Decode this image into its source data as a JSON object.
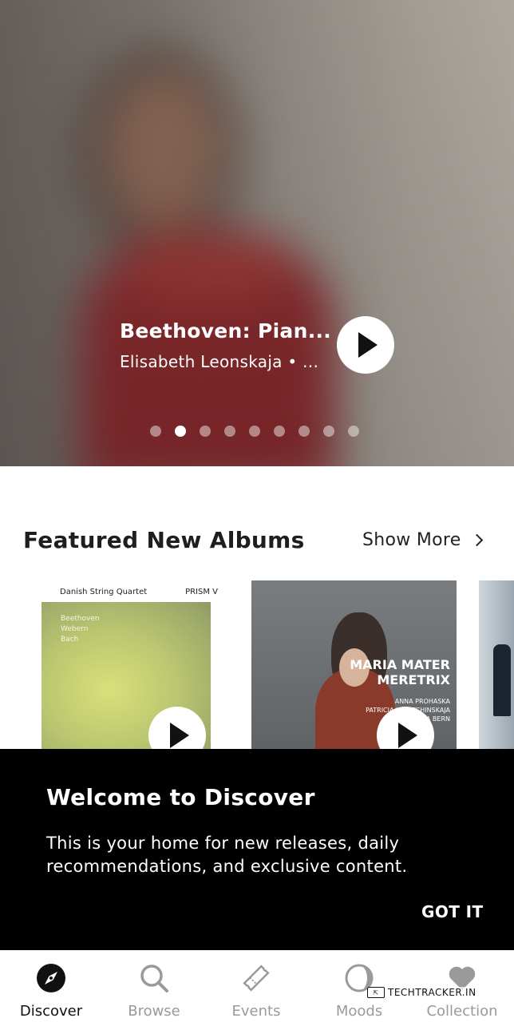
{
  "hero": {
    "title": "Beethoven: Pian...",
    "subtitle": "Elisabeth Leonskaja • ...",
    "carousel_count": 9,
    "carousel_active_index": 1
  },
  "featured": {
    "title": "Featured New Albums",
    "show_more": "Show More",
    "albums": [
      {
        "top_left": "Danish String Quartet",
        "top_right": "PRISM V",
        "names": [
          "Beethoven",
          "Webern",
          "Bach"
        ]
      },
      {
        "title_lines": [
          "MARIA MATER",
          "MERETRIX"
        ],
        "credits": [
          "ANNA PROHASKA",
          "PATRICIA KOPATCHINSKAJA",
          "CAMERATA BERN"
        ]
      },
      {}
    ]
  },
  "welcome": {
    "title": "Welcome to Discover",
    "body": "This is your home for new releases, daily recommendations, and exclusive content.",
    "dismiss": "GOT IT"
  },
  "tabs": [
    {
      "label": "Discover",
      "icon": "compass-icon",
      "active": true
    },
    {
      "label": "Browse",
      "icon": "search-icon",
      "active": false
    },
    {
      "label": "Events",
      "icon": "ticket-icon",
      "active": false
    },
    {
      "label": "Moods",
      "icon": "moon-icon",
      "active": false
    },
    {
      "label": "Collection",
      "icon": "heart-icon",
      "active": false
    }
  ],
  "watermark": "TECHTRACKER.IN",
  "colors": {
    "overlay_bg": "#000000",
    "active_tab": "#111111",
    "inactive_tab": "#9a9a9a"
  }
}
